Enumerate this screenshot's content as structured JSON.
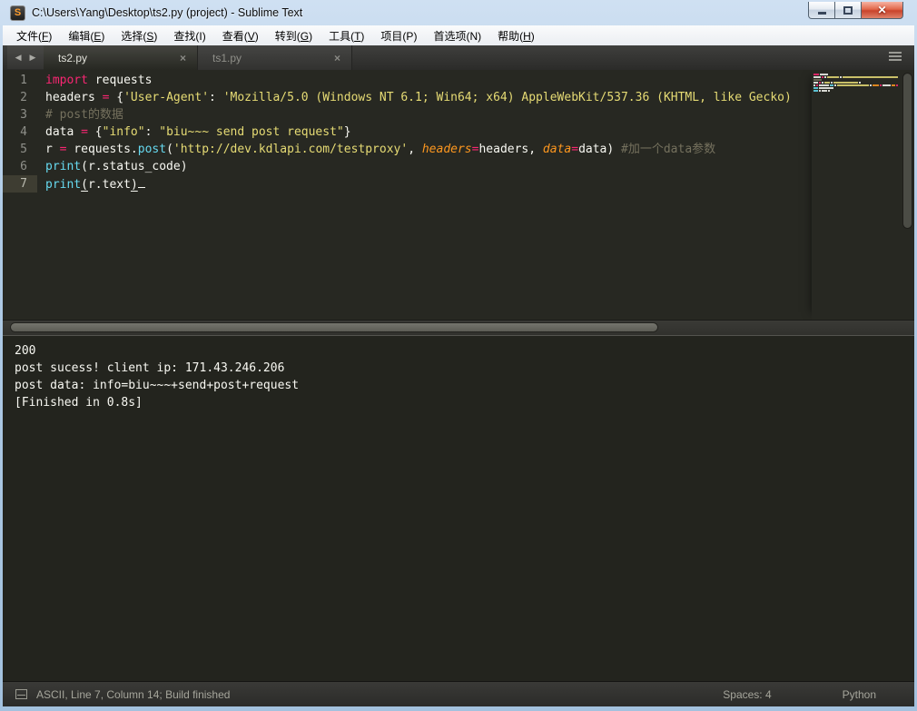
{
  "window": {
    "title": "C:\\Users\\Yang\\Desktop\\ts2.py (project) - Sublime Text",
    "icon_letter": "S",
    "controls": {
      "minimize": "minimize",
      "maximize": "maximize",
      "close": "close"
    }
  },
  "menu": {
    "items": [
      {
        "pre": "文件(",
        "key": "F",
        "post": ")",
        "u": true
      },
      {
        "pre": "编辑(",
        "key": "E",
        "post": ")",
        "u": true
      },
      {
        "pre": "选择(",
        "key": "S",
        "post": ")",
        "u": true
      },
      {
        "pre": "查找(",
        "key": "I",
        "post": ")",
        "u": false
      },
      {
        "pre": "查看(",
        "key": "V",
        "post": ")",
        "u": true
      },
      {
        "pre": "转到(",
        "key": "G",
        "post": ")",
        "u": true
      },
      {
        "pre": "工具(",
        "key": "T",
        "post": ")",
        "u": true
      },
      {
        "pre": "项目(",
        "key": "P",
        "post": ")",
        "u": false
      },
      {
        "pre": "首选项(",
        "key": "N",
        "post": ")",
        "u": false
      },
      {
        "pre": "帮助(",
        "key": "H",
        "post": ")",
        "u": true
      }
    ]
  },
  "tabs": {
    "nav_left": "◀",
    "nav_right": "▶",
    "close_glyph": "×",
    "items": [
      {
        "label": "ts2.py",
        "active": true
      },
      {
        "label": "ts1.py",
        "active": false
      }
    ]
  },
  "editor": {
    "lines": [
      {
        "num": 1,
        "tokens": [
          [
            "import",
            "kw"
          ],
          [
            " requests",
            "fg"
          ]
        ]
      },
      {
        "num": 2,
        "tokens": [
          [
            "headers ",
            "fg"
          ],
          [
            "=",
            "kw"
          ],
          [
            " {",
            "fg"
          ],
          [
            "'User-Agent'",
            "str"
          ],
          [
            ": ",
            "fg"
          ],
          [
            "'Mozilla/5.0 (Windows NT 6.1; Win64; x64) AppleWebKit/537.36 (KHTML, like Gecko)",
            "str"
          ]
        ]
      },
      {
        "num": 3,
        "tokens": [
          [
            "# post的数据",
            "com"
          ]
        ]
      },
      {
        "num": 4,
        "tokens": [
          [
            "data ",
            "fg"
          ],
          [
            "=",
            "kw"
          ],
          [
            " {",
            "fg"
          ],
          [
            "\"info\"",
            "str"
          ],
          [
            ": ",
            "fg"
          ],
          [
            "\"biu~~~ send post request\"",
            "str"
          ],
          [
            "}",
            "fg"
          ]
        ]
      },
      {
        "num": 5,
        "tokens": [
          [
            "r ",
            "fg"
          ],
          [
            "=",
            "kw"
          ],
          [
            " requests.",
            "fg"
          ],
          [
            "post",
            "fn"
          ],
          [
            "(",
            "fg"
          ],
          [
            "'http://dev.kdlapi.com/testproxy'",
            "str"
          ],
          [
            ", ",
            "fg"
          ],
          [
            "headers",
            "param"
          ],
          [
            "=",
            "kw"
          ],
          [
            "headers, ",
            "fg"
          ],
          [
            "data",
            "param"
          ],
          [
            "=",
            "kw"
          ],
          [
            "data) ",
            "fg"
          ],
          [
            "#加一个data参数",
            "com"
          ]
        ]
      },
      {
        "num": 6,
        "tokens": [
          [
            "print",
            "fn"
          ],
          [
            "(r.status_code)",
            "fg"
          ]
        ]
      },
      {
        "num": 7,
        "tokens": [
          [
            "print",
            "fn"
          ],
          [
            "(",
            "fgu"
          ],
          [
            "r.text",
            "fg"
          ],
          [
            ")",
            "fgu"
          ]
        ],
        "current": true,
        "caret": true
      }
    ]
  },
  "console": {
    "lines": [
      "200",
      "post sucess! client ip: 171.43.246.206",
      "post data: info=biu~~~+send+post+request",
      "[Finished in 0.8s]"
    ]
  },
  "status_bar": {
    "left": "ASCII, Line 7, Column 14; Build finished",
    "spaces": "Spaces: 4",
    "syntax": "Python"
  },
  "colors": {
    "keyword": "#f92672",
    "string": "#e6db74",
    "comment": "#75715e",
    "function": "#66d9ef",
    "parameter": "#fd971f",
    "foreground": "#f8f8f2",
    "editor_bg": "#272822",
    "console_bg": "#23241e",
    "titlebar": "#aac7e4",
    "close_button": "#c8432c"
  }
}
